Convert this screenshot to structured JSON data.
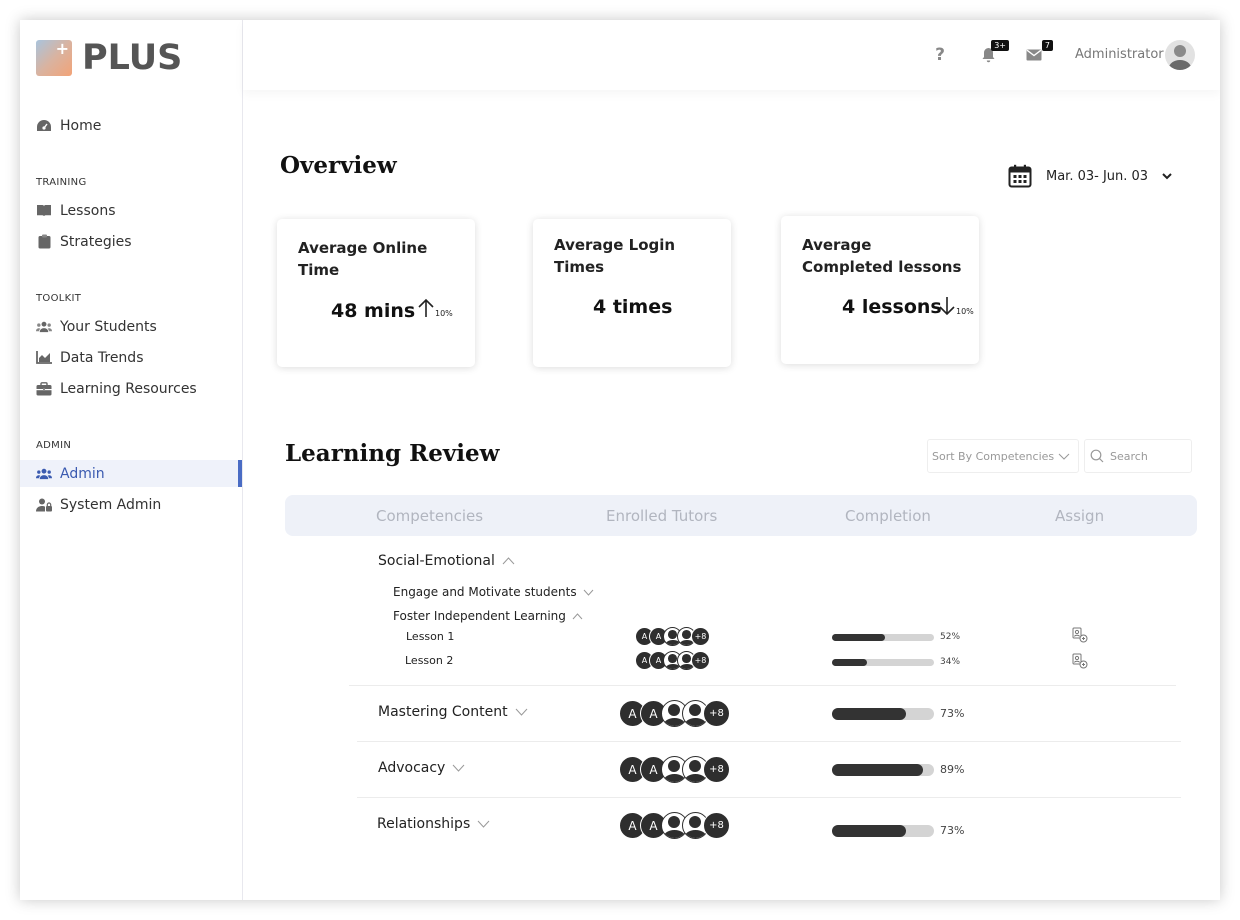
{
  "brand": {
    "name": "PLUS"
  },
  "sidebar": {
    "home": "Home",
    "sections": {
      "training": "TRAINING",
      "toolkit": "TOOLKIT",
      "admin": "ADMIN"
    },
    "training_items": [
      {
        "label": "Lessons",
        "icon": "book-icon"
      },
      {
        "label": "Strategies",
        "icon": "clipboard-icon"
      }
    ],
    "toolkit_items": [
      {
        "label": "Your Students",
        "icon": "users-icon"
      },
      {
        "label": "Data Trends",
        "icon": "chart-icon"
      },
      {
        "label": "Learning Resources",
        "icon": "briefcase-icon"
      }
    ],
    "admin_items": [
      {
        "label": "Admin",
        "icon": "users-gear-icon",
        "active": true
      },
      {
        "label": "System Admin",
        "icon": "user-lock-icon"
      }
    ]
  },
  "topbar": {
    "help": "?",
    "notifications_badge": "3+",
    "messages_badge": "7",
    "user_name": "Administrator"
  },
  "overview": {
    "title": "Overview",
    "date_range": "Mar. 03- Jun. 03",
    "cards": [
      {
        "title": "Average Online Time",
        "value": "48 mins",
        "trend_dir": "up",
        "trend_pct": "10%"
      },
      {
        "title": "Average Login Times",
        "value": "4 times"
      },
      {
        "title": "Average Completed lessons",
        "value": "4 lessons",
        "trend_dir": "down",
        "trend_pct": "10%"
      }
    ]
  },
  "review": {
    "title": "Learning Review",
    "sort_label": "Sort By Competencies",
    "search_placeholder": "Search",
    "columns": [
      "Competencies",
      "Enrolled Tutors",
      "Completion",
      "Assign"
    ],
    "social": {
      "label": "Social-Emotional",
      "subs": [
        {
          "label": "Engage and Motivate students",
          "expanded": false
        },
        {
          "label": "Foster Independent Learning",
          "expanded": true
        }
      ],
      "lessons": [
        {
          "label": "Lesson 1",
          "tutor_initials": [
            "A",
            "A"
          ],
          "tutor_more": "+8",
          "completion": 0.52,
          "completion_text": "52%"
        },
        {
          "label": "Lesson 2",
          "tutor_initials": [
            "A",
            "A"
          ],
          "tutor_more": "+8",
          "completion": 0.34,
          "completion_text": "34%"
        }
      ]
    },
    "rows": [
      {
        "label": "Mastering Content",
        "tutor_initials": [
          "A",
          "A"
        ],
        "tutor_more": "+8",
        "completion": 0.73,
        "completion_text": "73%"
      },
      {
        "label": "Advocacy",
        "tutor_initials": [
          "A",
          "A"
        ],
        "tutor_more": "+8",
        "completion": 0.89,
        "completion_text": "89%"
      },
      {
        "label": "Relationships",
        "tutor_initials": [
          "A",
          "A"
        ],
        "tutor_more": "+8",
        "completion": 0.73,
        "completion_text": "73%"
      }
    ]
  },
  "colors": {
    "accent": "#4a6cc4",
    "bar_fill": "#333333",
    "bar_track": "#d4d4d4",
    "header_bg": "#eef1f8"
  }
}
